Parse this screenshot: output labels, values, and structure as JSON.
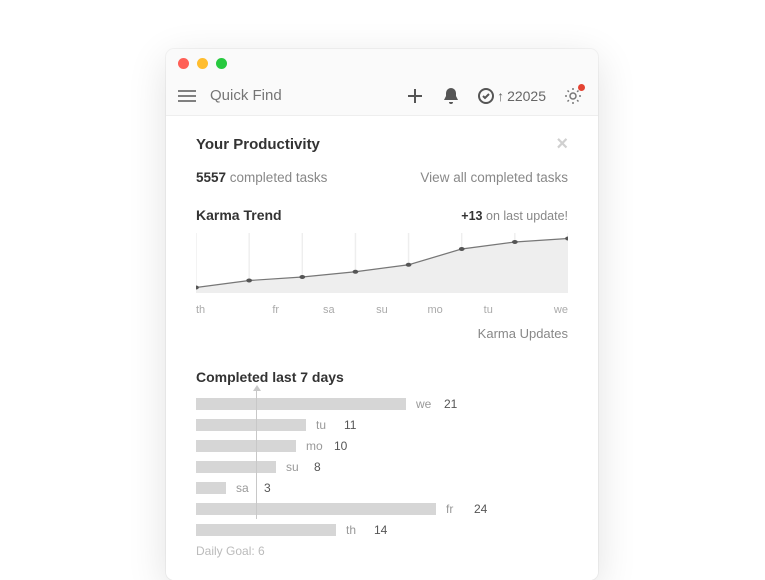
{
  "toolbar": {
    "search_placeholder": "Quick Find",
    "karma_count": "22025"
  },
  "panel": {
    "title": "Your Productivity",
    "completed_count": "5557",
    "completed_label": " completed tasks",
    "view_all": "View all completed tasks",
    "karma_trend_title": "Karma Trend",
    "karma_delta": "+13",
    "karma_delta_suffix": " on last update!",
    "karma_updates": "Karma Updates",
    "last7_title": "Completed last 7 days",
    "daily_goal_label": "Daily Goal: ",
    "daily_goal_value": "6"
  },
  "chart_data": [
    {
      "type": "area",
      "title": "Karma Trend",
      "categories": [
        "th",
        "fr",
        "sa",
        "su",
        "mo",
        "tu",
        "we"
      ],
      "values": [
        2,
        6,
        8,
        11,
        15,
        24,
        28,
        30
      ],
      "ylim": [
        0,
        32
      ]
    },
    {
      "type": "bar",
      "orientation": "horizontal",
      "title": "Completed last 7 days",
      "categories": [
        "we",
        "tu",
        "mo",
        "su",
        "sa",
        "fr",
        "th"
      ],
      "values": [
        21,
        11,
        10,
        8,
        3,
        24,
        14
      ],
      "goal": 6,
      "xlim": [
        0,
        24
      ]
    }
  ]
}
